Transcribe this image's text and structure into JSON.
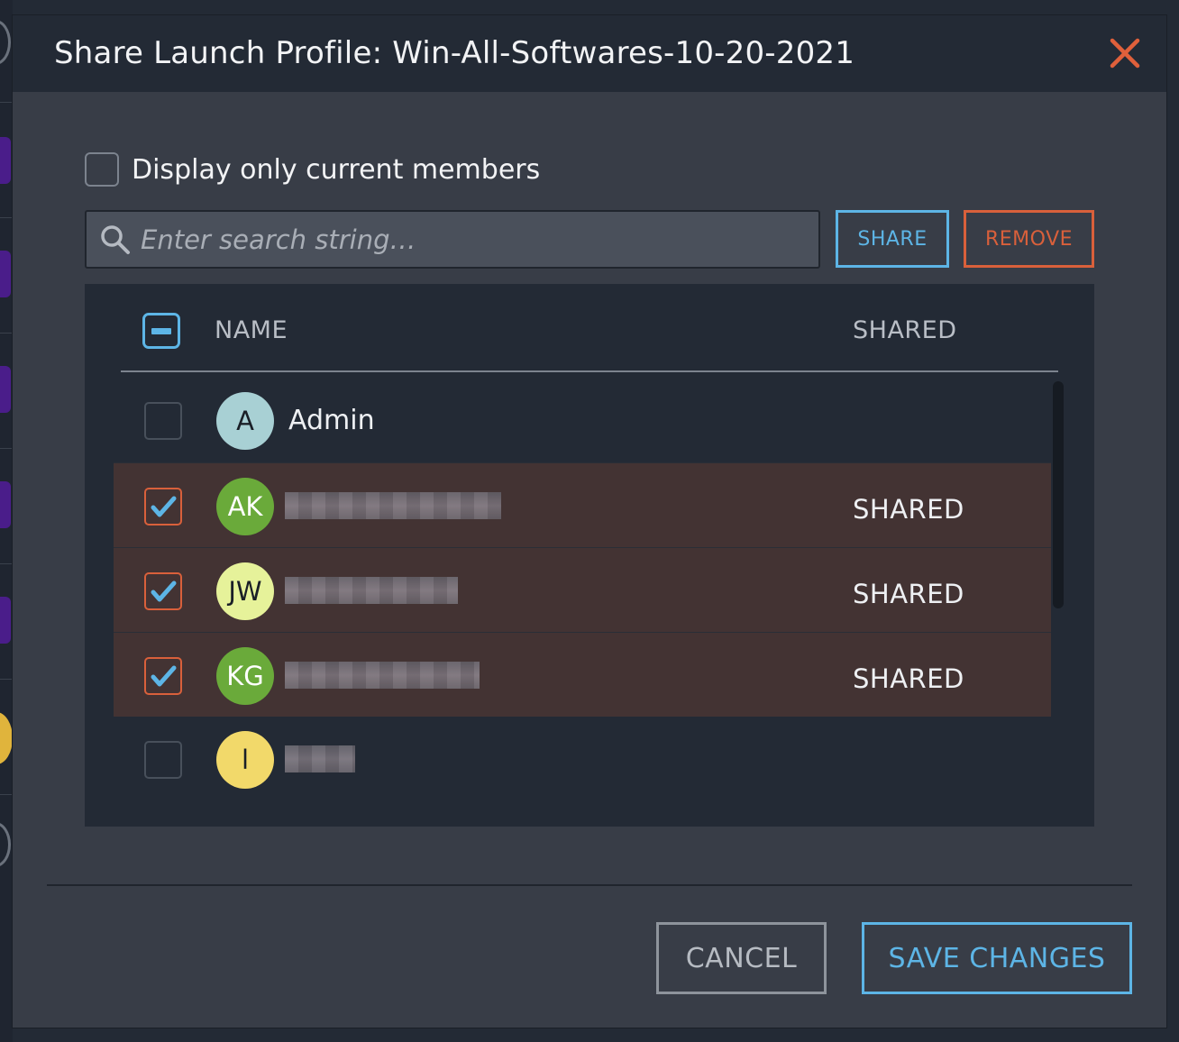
{
  "dialog": {
    "title": "Share Launch Profile: Win-All-Softwares-10-20-2021"
  },
  "filter": {
    "label": "Display only current members",
    "checked": false
  },
  "search": {
    "placeholder": "Enter search string…",
    "value": ""
  },
  "actions": {
    "share_label": "SHARE",
    "remove_label": "REMOVE"
  },
  "table": {
    "columns": {
      "name": "NAME",
      "shared": "SHARED"
    },
    "rows": [
      {
        "initials": "A",
        "name": "Admin",
        "shared": "",
        "checked": false,
        "avatar_color": "#a8d0d4",
        "avatar_text_color": "#1a1f27"
      },
      {
        "initials": "AK",
        "name": "",
        "shared": "SHARED",
        "checked": true,
        "avatar_color": "#6aaa3a",
        "avatar_text_color": "#ffffff"
      },
      {
        "initials": "JW",
        "name": "",
        "shared": "SHARED",
        "checked": true,
        "avatar_color": "#e6f29a",
        "avatar_text_color": "#1a1f27"
      },
      {
        "initials": "KG",
        "name": "",
        "shared": "SHARED",
        "checked": true,
        "avatar_color": "#6aaa3a",
        "avatar_text_color": "#ffffff"
      },
      {
        "initials": "l",
        "name": "",
        "shared": "",
        "checked": false,
        "avatar_color": "#f2d96a",
        "avatar_text_color": "#1a1f27"
      }
    ]
  },
  "footer": {
    "cancel_label": "CANCEL",
    "save_label": "SAVE CHANGES"
  },
  "colors": {
    "accent": "#5db5e6",
    "danger": "#d9603b",
    "selected_row": "#433333",
    "dialog_bg": "#383d47",
    "header_bg": "#232a35"
  },
  "icons": {
    "close": "close-icon",
    "search": "search-icon",
    "check": "checkmark-icon",
    "indeterminate": "minus-icon"
  }
}
